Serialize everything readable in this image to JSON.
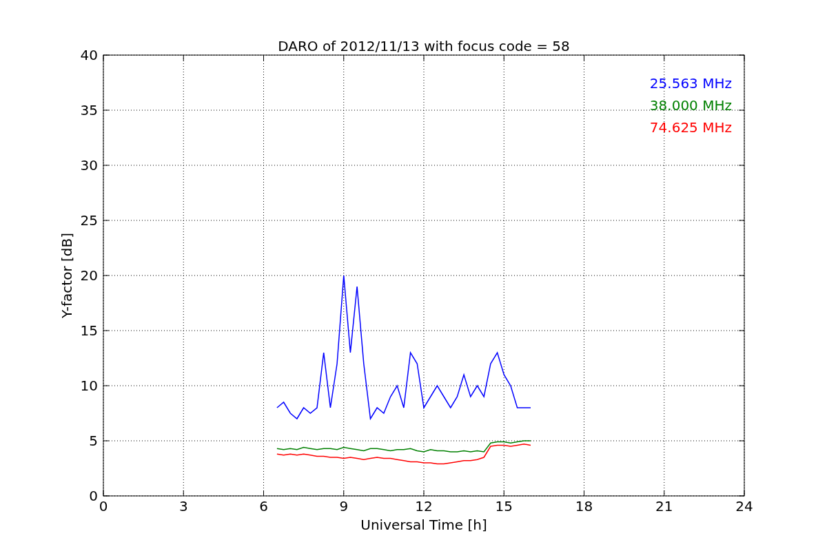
{
  "chart_data": {
    "type": "line",
    "title": "DARO of 2012/11/13 with focus code = 58",
    "xlabel": "Universal Time [h]",
    "ylabel": "Y-factor [dB]",
    "x": [
      6.5,
      6.75,
      7,
      7.25,
      7.5,
      7.75,
      8,
      8.25,
      8.5,
      8.75,
      9,
      9.25,
      9.5,
      9.75,
      10,
      10.25,
      10.5,
      10.75,
      11,
      11.25,
      11.5,
      11.75,
      12,
      12.25,
      12.5,
      12.75,
      13,
      13.25,
      13.5,
      13.75,
      14,
      14.25,
      14.5,
      14.75,
      15,
      15.25,
      15.5,
      15.75,
      16
    ],
    "series": [
      {
        "name": "25.563 MHz",
        "color": "#0000ff",
        "values": [
          8,
          8.5,
          7.5,
          7,
          8,
          7.5,
          8,
          13,
          8,
          12,
          20,
          13,
          19,
          12,
          7,
          8,
          7.5,
          9,
          10,
          8,
          13,
          12,
          8,
          9,
          10,
          9,
          8,
          9,
          11,
          9,
          10,
          9,
          12,
          13,
          11,
          10,
          8,
          8,
          8
        ]
      },
      {
        "name": "38.000 MHz",
        "color": "#008000",
        "values": [
          4.3,
          4.2,
          4.3,
          4.2,
          4.4,
          4.3,
          4.2,
          4.3,
          4.3,
          4.2,
          4.4,
          4.3,
          4.2,
          4.1,
          4.3,
          4.3,
          4.2,
          4.1,
          4.2,
          4.2,
          4.3,
          4.1,
          4,
          4.2,
          4.1,
          4.1,
          4,
          4,
          4.1,
          4,
          4.1,
          4,
          4.8,
          4.9,
          4.9,
          4.8,
          4.9,
          5,
          5
        ]
      },
      {
        "name": "74.625 MHz",
        "color": "#ff0000",
        "values": [
          3.8,
          3.7,
          3.8,
          3.7,
          3.8,
          3.7,
          3.6,
          3.6,
          3.5,
          3.5,
          3.4,
          3.5,
          3.4,
          3.3,
          3.4,
          3.5,
          3.4,
          3.4,
          3.3,
          3.2,
          3.1,
          3.1,
          3.0,
          3.0,
          2.9,
          2.9,
          3.0,
          3.1,
          3.2,
          3.2,
          3.3,
          3.5,
          4.5,
          4.6,
          4.6,
          4.5,
          4.6,
          4.7,
          4.6
        ]
      }
    ],
    "xlim": [
      0,
      24
    ],
    "ylim": [
      0,
      40
    ],
    "xticks": [
      0,
      3,
      6,
      9,
      12,
      15,
      18,
      21,
      24
    ],
    "yticks": [
      0,
      5,
      10,
      15,
      20,
      25,
      30,
      35,
      40
    ],
    "grid": true
  }
}
